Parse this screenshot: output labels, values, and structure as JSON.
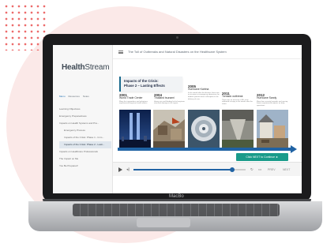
{
  "device": {
    "brand_label": "MacBo"
  },
  "app": {
    "logo_main": "Health",
    "logo_suffix": "Stream"
  },
  "sidebar": {
    "tabs": [
      "Menu",
      "Resources",
      "Notes"
    ],
    "items": [
      {
        "label": "Learning Objectives",
        "level": 1,
        "active": false
      },
      {
        "label": "Emergency Preparedness",
        "level": 1,
        "active": false
      },
      {
        "label": "Impacts on Health Systems and Pra...",
        "level": 1,
        "active": false
      },
      {
        "label": "Emergency Process",
        "level": 2,
        "active": false
      },
      {
        "label": "Impacts of the Crisis: Phase 1 - Imm...",
        "level": 2,
        "active": false
      },
      {
        "label": "Impacts of the Crisis: Phase 2 - Lasti...",
        "level": 2,
        "active": true
      },
      {
        "label": "Impacts on Healthcare Professionals",
        "level": 1,
        "active": false
      },
      {
        "label": "The Impact on Me",
        "level": 1,
        "active": false
      },
      {
        "label": "You Be Prepared!",
        "level": 1,
        "active": false
      }
    ]
  },
  "header": {
    "course_title": "The Toll of Outbreaks and Natural Disasters on the Healthcare System"
  },
  "slide": {
    "title_line1": "Impacts of the Crisis:",
    "title_line2": "Phase 2 – Lasting Effects",
    "events": [
      {
        "year": "2001",
        "name": "World Trade Center",
        "desc": "Many first responders and volunteers experienced long-term health effects."
      },
      {
        "year": "2004",
        "name": "Thailand tsunami",
        "desc": "Heavy rain and flooding led to long-term structural damage in the region."
      },
      {
        "year": "2005",
        "name": "Hurricane Katrina",
        "desc": "In the month after the disaster, there was an increase in emergency admissions for diabetic patients due to disruption in the delivery of care."
      },
      {
        "year": "2011",
        "name": "Tornado outbreak",
        "desc": "There was an increase in ED visits attributed to injury in the weeks after the storm."
      },
      {
        "year": "2012",
        "name": "Hurricane Sandy",
        "desc": "More than seventy hospitals and nursing homes experienced impacts on daily operations."
      }
    ],
    "next_button_text": "Click NEXT to Continue  ►"
  },
  "player": {
    "progress_fraction": 0.88,
    "prev_label": "PREV",
    "next_label": "NEXT"
  },
  "colors": {
    "timeline": "#2063a4",
    "next_button": "#1a9b8a",
    "active_nav_bg": "#e0e7ee"
  }
}
